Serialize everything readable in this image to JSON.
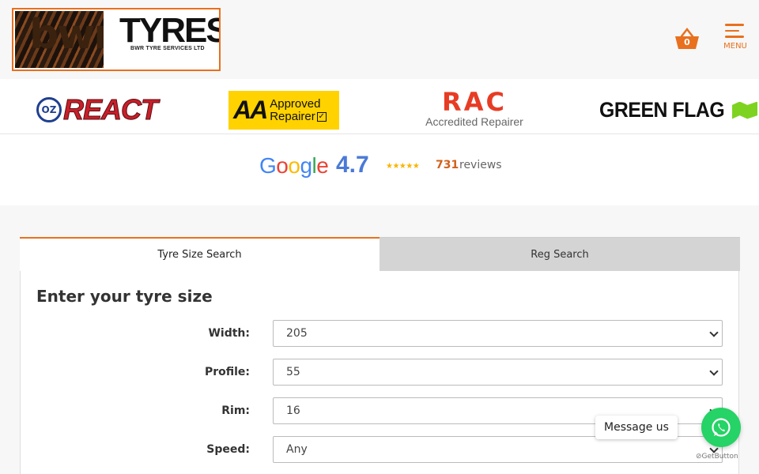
{
  "header": {
    "logo": {
      "wordmark": "bwr",
      "name": "TYRES",
      "subtitle": "BWR TYRE SERVICES LTD"
    },
    "basket": {
      "count": "0"
    },
    "menu": {
      "label": "MENU"
    }
  },
  "partners": {
    "react": {
      "badge": "OZ",
      "text": "REACT"
    },
    "aa": {
      "big": "AA",
      "line1": "Approved",
      "line2": "Repairer"
    },
    "rac": {
      "brand": "RAC",
      "line": "Accredited Repairer"
    },
    "green_flag": {
      "text": "GREEN FLAG"
    }
  },
  "rating": {
    "provider": "Google",
    "score": "4.7",
    "stars": "★★★★★",
    "count": "731",
    "reviews_label": "reviews"
  },
  "search": {
    "tabs": [
      {
        "label": "Tyre Size Search",
        "active": true
      },
      {
        "label": "Reg Search",
        "active": false
      }
    ],
    "title": "Enter your tyre size",
    "fields": [
      {
        "label": "Width:",
        "value": "205"
      },
      {
        "label": "Profile:",
        "value": "55"
      },
      {
        "label": "Rim:",
        "value": "16"
      },
      {
        "label": "Speed:",
        "value": "Any"
      }
    ]
  },
  "widget": {
    "message_label": "Message us",
    "powered_by": "GetButton"
  },
  "colors": {
    "accent": "#e8701e",
    "whatsapp": "#25d366",
    "google_score": "#4a7ad6"
  }
}
